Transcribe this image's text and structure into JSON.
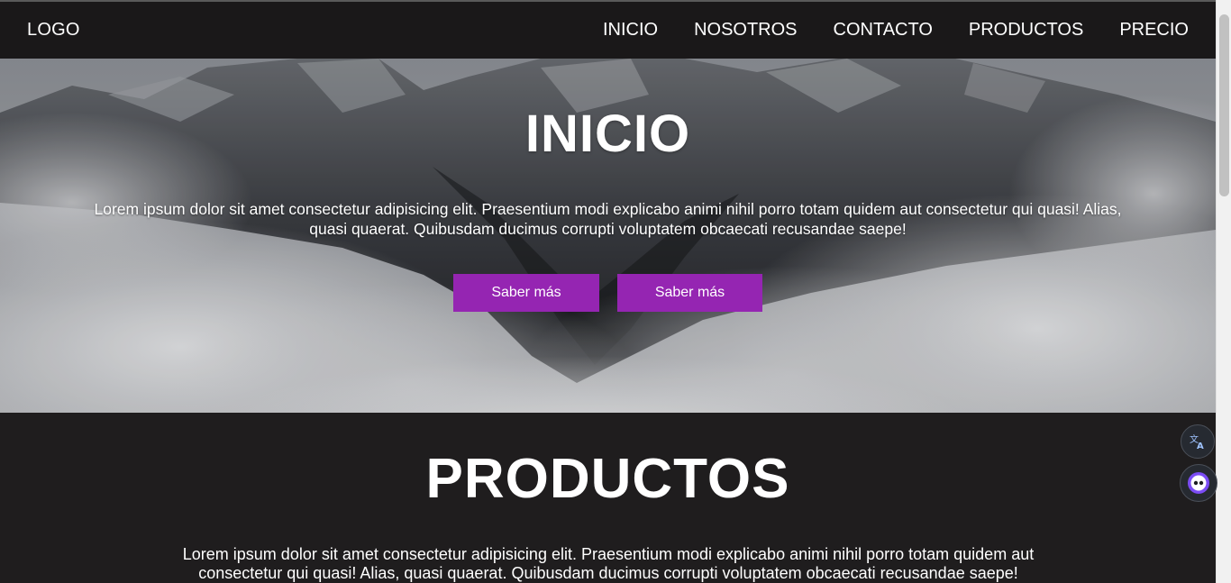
{
  "nav": {
    "logo": "LOGO",
    "links": [
      "INICIO",
      "NOSOTROS",
      "CONTACTO",
      "PRODUCTOS",
      "PRECIO"
    ]
  },
  "hero": {
    "title": "INICIO",
    "text": "Lorem ipsum dolor sit amet consectetur adipisicing elit. Praesentium modi explicabo animi nihil porro totam quidem aut consectetur qui quasi! Alias, quasi quaerat. Quibusdam ducimus corrupti voluptatem obcaecati recusandae saepe!",
    "buttons": [
      "Saber más",
      "Saber más"
    ]
  },
  "products": {
    "title": "PRODUCTOS",
    "text": "Lorem ipsum dolor sit amet consectetur adipisicing elit. Praesentium modi explicabo animi nihil porro totam quidem aut consectetur qui quasi! Alias, quasi quaerat. Quibusdam ducimus corrupti voluptatem obcaecati recusandae saepe!"
  },
  "widgets": {
    "translate_icon": "translate-icon",
    "assistant_icon": "assistant-face-icon"
  },
  "colors": {
    "nav_bg": "#1a1819",
    "accent": "#9525b2",
    "section_bg": "#1f1d1e",
    "text": "#ffffff"
  }
}
